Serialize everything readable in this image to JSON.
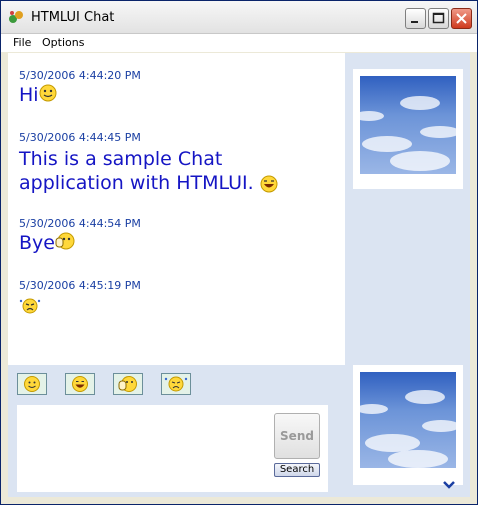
{
  "window": {
    "title": "HTMLUI Chat",
    "app_icon": "chat-app-icon"
  },
  "titlebar_buttons": [
    "minimize-icon",
    "maximize-icon",
    "close-icon"
  ],
  "menu": {
    "file": "File",
    "options": "Options"
  },
  "messages": [
    {
      "timestamp": "5/30/2006 4:44:20 PM",
      "text": "Hi",
      "emote": "smile"
    },
    {
      "timestamp": "5/30/2006 4:44:45 PM",
      "text": "This is a sample Chat",
      "text2": "application with HTMLUI.",
      "emote": "laugh"
    },
    {
      "timestamp": "5/30/2006 4:44:54 PM",
      "text": "Bye",
      "emote": "wave"
    },
    {
      "timestamp": "5/30/2006 4:45:19 PM",
      "text": "",
      "emote": "cry"
    }
  ],
  "emote_buttons": [
    "smile",
    "laugh",
    "wave",
    "cry"
  ],
  "input": {
    "value": ""
  },
  "buttons": {
    "send": "Send",
    "search": "Search"
  },
  "colors": {
    "timestamp": "#1a3fa3",
    "message_text": "#1515c4",
    "panel_bg": "#dbe4f2",
    "emote_btn_bg": "#e4f2e8"
  }
}
